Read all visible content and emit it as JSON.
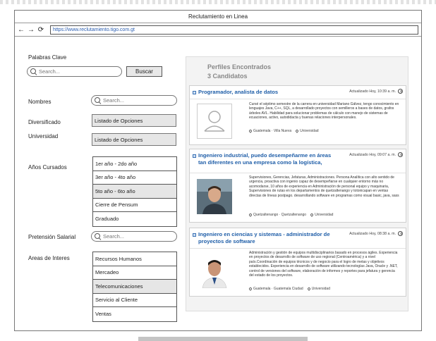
{
  "window": {
    "title": "Reclutamiento en Linea",
    "url": "https://www.reclutamiento.tigo.com.gt"
  },
  "icons": {
    "back": "back-arrow-icon",
    "forward": "forward-arrow-icon",
    "reload": "reload-icon",
    "search": "search-icon",
    "clock": "clock-icon",
    "location": "location-pin-icon"
  },
  "filters": {
    "keywords_label": "Palabras Clave",
    "search_placeholder": "Search...",
    "search_button": "Buscar",
    "names_label": "Nombres",
    "names_placeholder": "Search...",
    "diversified_label": "Diversificado",
    "diversified_value": "Listado de Opciones",
    "university_label": "Universidad",
    "university_value": "Listado de Opciones",
    "years_label": "Años Cursados",
    "years_options": [
      "1er año - 2do año",
      "3er año - 4to año",
      "5to año - 6to año",
      "Cierre de Pensum",
      "Graduado"
    ],
    "years_selected": 2,
    "salary_label": "Pretensión Salarial",
    "salary_placeholder": "Search...",
    "areas_label": "Areas de Interes",
    "areas_options": [
      "Recursos Humanos",
      "Mercadeo",
      "Telecomunicaciones",
      "Servicio al Cliente",
      "Ventas"
    ],
    "areas_selected": 2
  },
  "results": {
    "heading": "Perfiles Encontrados",
    "count": "3 Candidatos",
    "profiles": [
      {
        "title": "Programador, analista de datos",
        "updated": "Actualizado Hoy, 10:39 a. m.",
        "description": "Cursé el séptimo semestre de la carrera en universidad Mariano Gálvez, tengo conocimiento en lenguajes Java, C++, SQL, a desarrollado proyectos con semilleros a bases de datos, grafos árboles AVL. Habilidad para solucionar problemas de cálculo con manejo de sistemas de ecuaciones, activo, autodidacta y buenas relaciones interpersonales.",
        "location": "Guatemala · Villa Nueva",
        "type": "Universidad",
        "photo": "placeholder"
      },
      {
        "title": "Ingeniero industrial, puedo desempeñarme en áreas tan diferentes en una empresa como la logística,",
        "updated": "Actualizado Hoy, 09:07 a. m.",
        "description": "Supervisiones, Gerencias, Jefaturas, Administraciones. Persona Analítica con alto sentido de urgencia, proactiva con ingenio capaz de desempeñarse en cualquier entorno más no acomodarse, 10 años de experiencia en Administración de personal equipo y maquinaria, Supervisiones de rutas en los departamentos de quetzaltenango y totonicapan en ventas directas de líneas postpago. desarrollando software en programas como visual basic, java, sass",
        "location": "Quetzaltenango · Quetzaltenango",
        "type": "Universidad",
        "photo": "person"
      },
      {
        "title": "Ingeniero en ciencias y sistemas - administrador de proyectos de software",
        "updated": "Actualizado Hoy, 08:38 a. m.",
        "description": "Administración y gestión de equipos multidisciplinarios basado en procesos ágiles. Experiencia en proyectos de desarrollo de software de uso regional (Centroamérica) y a nivel país.Coordinación de equipos técnicos y de negocio para el logro de metas y objetivos establecidos. Experiencia en desarrollo de software utilizando tecnologías Java, Oracle y .NET, control de versiones del software, elaboración de informes y reportes para jefatura y gerencia del estado de los proyectos.",
        "location": "Guatemala · Guatemala Ciudad",
        "type": "Universidad",
        "photo": "person"
      }
    ]
  }
}
